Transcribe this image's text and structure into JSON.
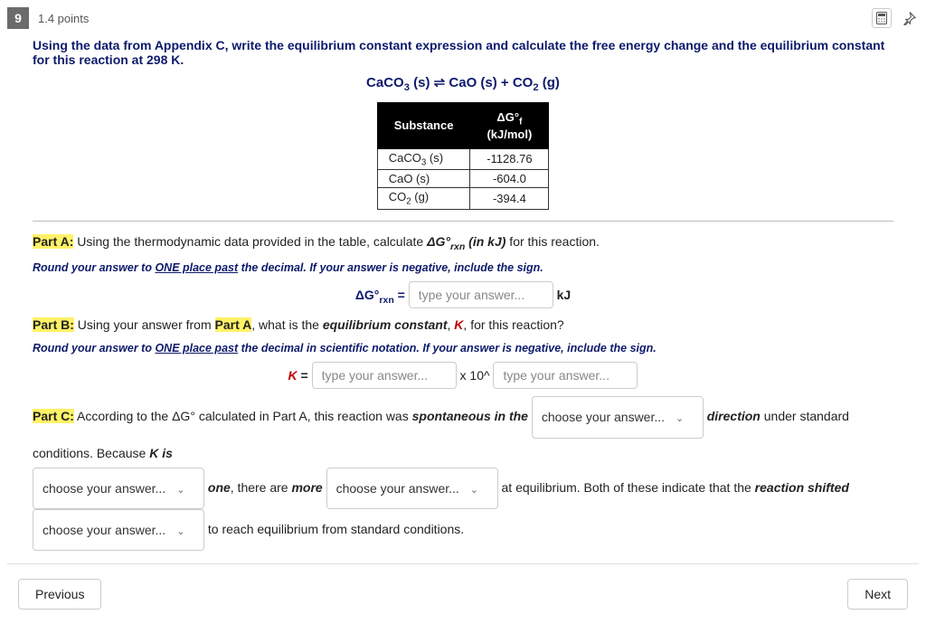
{
  "header": {
    "qnum": "9",
    "points": "1.4 points"
  },
  "prompt": "Using the data from Appendix C, write the equilibrium constant expression and calculate the free energy change and the equilibrium constant for this reaction at 298 K.",
  "equation_html": "CaCO<sub>3</sub> (s) ⇌ CaO (s) + CO<sub>2</sub> (g)",
  "table": {
    "col1": "Substance",
    "col2_html": "ΔG°<sub>f</sub><br>(kJ/mol)",
    "rows": [
      {
        "sub_html": "CaCO<sub>3</sub> (s)",
        "val": "-1128.76"
      },
      {
        "sub_html": "CaO (s)",
        "val": "-604.0"
      },
      {
        "sub_html": "CO<sub>2</sub> (g)",
        "val": "-394.4"
      }
    ]
  },
  "partA": {
    "label": "Part A:",
    "text_html": " Using the thermodynamic data provided in the table, calculate <b><i>ΔG°<sub>rxn</sub> (in kJ)</i></b> for this reaction.",
    "hint_html": "Round your answer to <u>ONE place past</u> the decimal. If your answer is negative, include the sign.",
    "eq_label_html": "ΔG°<sub>rxn</sub> =",
    "unit": "kJ",
    "placeholder": "type your answer..."
  },
  "partB": {
    "label": "Part B:",
    "text_before": " Using your answer from ",
    "ref": "Part A",
    "text_after_html": ", what is the <b><i>equilibrium constant</i></b>, <span class='k-label'>K</span>, for this reaction?",
    "hint_html": "Round your answer to <u>ONE place past</u> the decimal in scientific notation. If your answer is negative, include the sign.",
    "k_eq": "K",
    "times": " x 10^ ",
    "placeholder": "type your answer..."
  },
  "partC": {
    "label": "Part C:",
    "seg1": " According to the ΔG° calculated in Part A, this reaction was ",
    "seg1b": "spontaneous in the",
    "seg2": " direction",
    "seg2b": " under standard conditions. Because ",
    "seg2c": "K is",
    "seg3a": "one",
    "seg3b": ", there are ",
    "seg3c": "more",
    "seg4": " at equilibrium. Both of these indicate that the ",
    "seg4b": "reaction shifted",
    "seg5": " to reach equilibrium from standard conditions.",
    "select_placeholder": "choose your answer..."
  },
  "footer": {
    "prev": "Previous",
    "next": "Next"
  }
}
